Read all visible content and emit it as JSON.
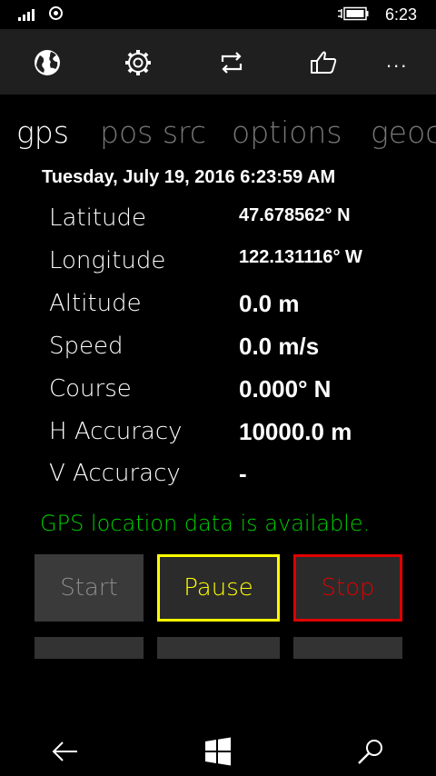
{
  "status": {
    "time": "6:23"
  },
  "appbar": {
    "icons": [
      "globe-icon",
      "gear-icon",
      "repeat-icon",
      "thumbs-up-icon"
    ],
    "more": "..."
  },
  "pivot": {
    "tabs": [
      "gps",
      "pos src",
      "options",
      "geoc"
    ],
    "active": "gps"
  },
  "datetime": "Tuesday, July 19, 2016 6:23:59 AM",
  "readings": {
    "latitude": {
      "label": "Latitude",
      "value": "47.678562° N"
    },
    "longitude": {
      "label": "Longitude",
      "value": "122.131116° W"
    },
    "altitude": {
      "label": "Altitude",
      "value": "0.0 m"
    },
    "speed": {
      "label": "Speed",
      "value": "0.0 m/s"
    },
    "course": {
      "label": "Course",
      "value": "0.000° N"
    },
    "h_accuracy": {
      "label": "H Accuracy",
      "value": "10000.0 m"
    },
    "v_accuracy": {
      "label": "V Accuracy",
      "value": "-"
    }
  },
  "status_message": "GPS location data is available.",
  "buttons": {
    "start": "Start",
    "pause": "Pause",
    "stop": "Stop"
  },
  "colors": {
    "status_ok": "#00d000",
    "pause": "#ffff00",
    "stop": "#e00000"
  }
}
